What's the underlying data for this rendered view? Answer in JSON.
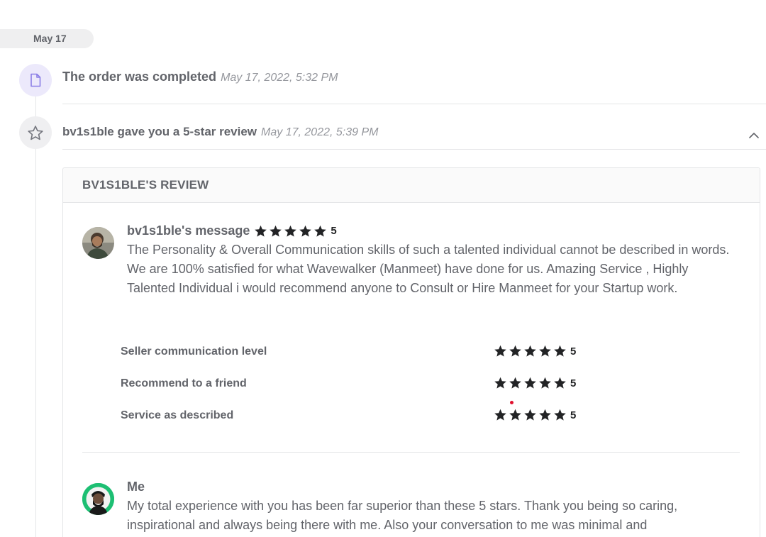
{
  "timeline": {
    "date_label": "May 17",
    "events": [
      {
        "title": "The order was completed",
        "time": "May 17, 2022, 5:32 PM",
        "icon": "document-icon"
      },
      {
        "title": "bv1s1ble gave you a 5-star review",
        "time": "May 17, 2022, 5:39 PM",
        "icon": "star-outline-icon"
      }
    ]
  },
  "review": {
    "header": "BV1S1BLE'S REVIEW",
    "buyer_message": {
      "author": "bv1s1ble's message",
      "stars": 5,
      "score": "5",
      "text": "The Personality & Overall Communication skills of such a talented individual cannot be described in words. We are 100% satisfied for what Wavewalker (Manmeet) have done for us. Amazing Service , Highly Talented Individual i would recommend anyone to Consult or Hire Manmeet for your Startup work."
    },
    "ratings": [
      {
        "label": "Seller communication level",
        "stars": 5,
        "score": "5"
      },
      {
        "label": "Recommend to a friend",
        "stars": 5,
        "score": "5"
      },
      {
        "label": "Service as described",
        "stars": 5,
        "score": "5"
      }
    ],
    "seller_reply": {
      "author": "Me",
      "text": "My total experience with you has been far superior than these 5 stars. Thank you being so caring, inspirational and always being there with me. Also your conversation to me was minimal and"
    }
  },
  "colors": {
    "accent_purple_bg": "#ece9fb",
    "accent_purple": "#8a7ee6",
    "star": "#222325",
    "avatar_green": "#1dbf73"
  }
}
